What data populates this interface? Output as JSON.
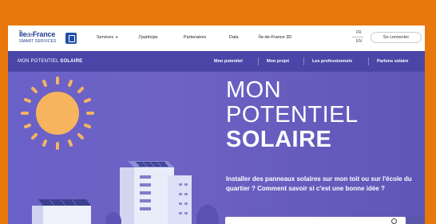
{
  "header": {
    "logo": {
      "line1": "Île",
      "line1_small": "de",
      "line1_end": "France",
      "sub": "SMART SERVICES",
      "badge_icon": "square-logo-icon"
    },
    "nav": [
      {
        "label": "Services",
        "has_dropdown": true
      },
      {
        "label": "J'participe"
      },
      {
        "label": "Partenaires"
      },
      {
        "label": "Data"
      },
      {
        "label": "Île-de-France 3D"
      }
    ],
    "lang": {
      "current": "FR",
      "alt": "EN"
    },
    "login_label": "Se connecter"
  },
  "subnav": {
    "title_regular": "MON POTENTIEL ",
    "title_bold": "SOLAIRE",
    "links": [
      "Mon potentiel",
      "Mon projet",
      "Les professionnels",
      "Parlons solaire"
    ]
  },
  "hero": {
    "title_lines": [
      "MON",
      "POTENTIEL",
      "SOLAIRE"
    ],
    "description": "Installer des panneaux solaires sur mon toit ou sur l'école du quartier ? Comment savoir si c'est une bonne idée ?",
    "search_icon": "search-icon"
  },
  "colors": {
    "frame": "#e8780c",
    "brand_blue": "#1f3b8f",
    "subnav_purple": "#4a46a7",
    "hero_purple": "#6a61c8",
    "sun": "#f6b45f"
  }
}
